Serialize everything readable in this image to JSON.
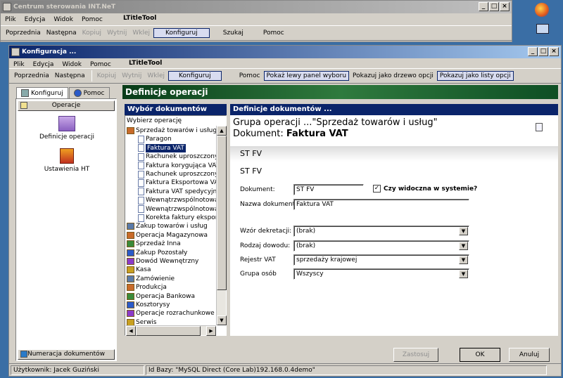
{
  "back_window": {
    "title": "Centrum sterowania INT.NeT",
    "menu": [
      "Plik",
      "Edycja",
      "Widok",
      "Pomoc"
    ],
    "ltitle": "LTitleTool",
    "toolbar": [
      "Poprzednia",
      "Następna",
      "Kopiuj",
      "Wytnij",
      "Wklej",
      "Konfiguruj",
      "Szukaj",
      "Pomoc"
    ]
  },
  "window": {
    "title": "Konfiguracja ...",
    "menu": [
      "Plik",
      "Edycja",
      "Widok",
      "Pomoc"
    ],
    "ltitle": "LTitleTool",
    "toolbar": {
      "prev": "Poprzednia",
      "next": "Następna",
      "copy": "Kopiuj",
      "cut": "Wytnij",
      "paste": "Wklej",
      "configure": "Konfiguruj",
      "help": "Pomoc",
      "show_left": "Pokaż lewy panel wyboru",
      "show_tree": "Pokazuj jako drzewo opcji",
      "show_list": "Pokazuj jako listy opcji"
    }
  },
  "left": {
    "tabs": [
      "Konfiguruj",
      "Pomoc"
    ],
    "section": "Operacje",
    "icons": [
      "Definicje operacji",
      "Ustawienia HT"
    ],
    "bottom_button": "Numeracja dokumentów"
  },
  "main": {
    "header": "Definicje operacji",
    "selector_header": "Wybór dokumentów",
    "selector_prompt": "Wybierz operację",
    "tree": [
      {
        "label": "Sprzedaż towarów i usług",
        "level": 0
      },
      {
        "label": "Paragon",
        "level": 1
      },
      {
        "label": "Faktura VAT",
        "level": 1,
        "selected": true
      },
      {
        "label": "Rachunek uproszczony",
        "level": 1
      },
      {
        "label": "Faktura korygująca VAT",
        "level": 1
      },
      {
        "label": "Rachunek uproszczony ko",
        "level": 1
      },
      {
        "label": "Faktura Eksportowa VAT",
        "level": 1
      },
      {
        "label": "Faktura VAT spedycyjna",
        "level": 1
      },
      {
        "label": "Wewnątrzwspólnotowa d",
        "level": 1
      },
      {
        "label": "Wewnątrzwspólnotowa d",
        "level": 1
      },
      {
        "label": "Korekta faktury eksporto",
        "level": 1
      },
      {
        "label": "Zakup towarów i usług",
        "level": 0
      },
      {
        "label": "Operacja Magazynowa",
        "level": 0
      },
      {
        "label": "Sprzedaż Inna",
        "level": 0
      },
      {
        "label": "Zakup Pozostały",
        "level": 0
      },
      {
        "label": "Dowód Wewnętrzny",
        "level": 0
      },
      {
        "label": "Kasa",
        "level": 0
      },
      {
        "label": "Zamówienie",
        "level": 0
      },
      {
        "label": "Produkcja",
        "level": 0
      },
      {
        "label": "Operacja Bankowa",
        "level": 0
      },
      {
        "label": "Kosztorysy",
        "level": 0
      },
      {
        "label": "Operacje rozrachunkowe",
        "level": 0
      },
      {
        "label": "Serwis",
        "level": 0
      }
    ],
    "def_header": "Definicje dokumentów ...",
    "group_line": "Grupa operacji ...\"Sprzedaż towarów i usług\"",
    "doc_prefix": "Dokument: ",
    "doc_name": "Faktura VAT",
    "code1": "ST FV",
    "code2": "ST FV",
    "form": {
      "document_label": "Dokument:",
      "document_value": "ST FV",
      "visible_label": "Czy widoczna w systemie?",
      "name_label": "Nazwa dokumentu:",
      "name_value": "Faktura VAT",
      "dekret_label": "Wzór dekretacji:",
      "dekret_value": "(brak)",
      "dowod_label": "Rodzaj dowodu:",
      "dowod_value": "(brak)",
      "vat_label": "Rejestr VAT",
      "vat_value": "sprzedaży krajowej",
      "grupa_label": "Grupa osób",
      "grupa_value": "Wszyscy"
    },
    "buttons": {
      "apply": "Zastosuj",
      "ok": "OK",
      "cancel": "Anuluj"
    }
  },
  "status": {
    "user": "Użytkownik: Jacek Guziński",
    "db": "Id Bazy: \"MySQL Direct (Core Lab)192.168.0.4demo\""
  }
}
